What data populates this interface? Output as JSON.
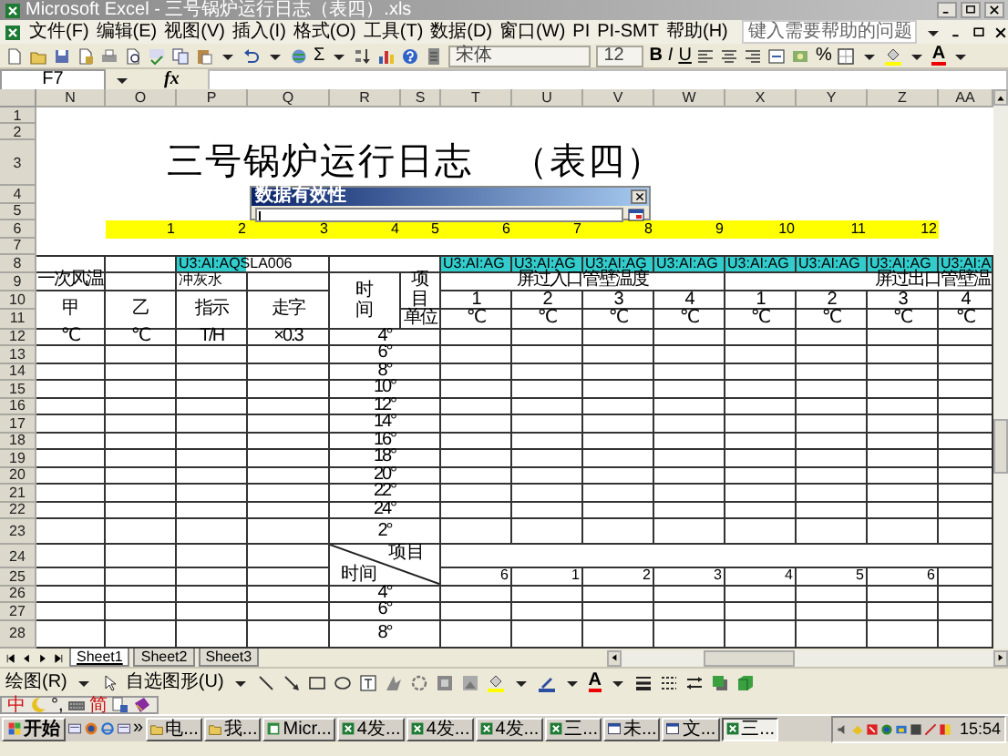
{
  "window": {
    "title": "Microsoft Excel - 三号锅炉运行日志（表四）.xls"
  },
  "menu": [
    "文件(F)",
    "编辑(E)",
    "视图(V)",
    "插入(I)",
    "格式(O)",
    "工具(T)",
    "数据(D)",
    "窗口(W)",
    "PI",
    "PI-SMT",
    "帮助(H)"
  ],
  "help_box": {
    "placeholder": "键入需要帮助的问题"
  },
  "toolbar": {
    "autosum": "Σ",
    "font": "宋体",
    "font_size": "12",
    "bold": "B",
    "italic": "I",
    "underline": "U",
    "percent": "%",
    "font_color": "A"
  },
  "formula_bar": {
    "name_box": "F7",
    "function": "fx"
  },
  "sheet": {
    "columns": [
      "N",
      "O",
      "P",
      "Q",
      "R",
      "S",
      "T",
      "U",
      "V",
      "W",
      "X",
      "Y",
      "Z",
      "AA"
    ],
    "rows": [
      {
        "label": "1"
      },
      {
        "label": "2"
      },
      {
        "label": "3",
        "cells": {
          "P": {
            "kind": "title",
            "text": "三号锅炉运行日志　（表四）"
          }
        }
      },
      {
        "label": "4"
      },
      {
        "label": "5"
      },
      {
        "label": "6",
        "cells": {
          "O": {
            "kind": "number",
            "text": "1",
            "color": "#ffff00"
          },
          "P": {
            "kind": "number",
            "text": "2",
            "color": "#ffff00"
          },
          "Q": {
            "kind": "number",
            "text": "3",
            "color": "#ffff00"
          },
          "R": {
            "kind": "number",
            "text": "4",
            "color": "#ffff00"
          },
          "S": {
            "kind": "number",
            "text": "5",
            "color": "#ffff00"
          },
          "T": {
            "kind": "number",
            "text": "6",
            "color": "#ffff00"
          },
          "U": {
            "kind": "number",
            "text": "7",
            "color": "#ffff00"
          },
          "V": {
            "kind": "number",
            "text": "8",
            "color": "#ffff00"
          },
          "W": {
            "kind": "number",
            "text": "9",
            "color": "#ffff00"
          },
          "X": {
            "kind": "number",
            "text": "10",
            "color": "#ffff00"
          },
          "Y": {
            "kind": "number",
            "text": "11",
            "color": "#ffff00"
          },
          "Z": {
            "kind": "number",
            "text": "12",
            "color": "#ffff00"
          }
        }
      },
      {
        "label": "7"
      },
      {
        "label": "8",
        "cells": {
          "P": {
            "kind": "label",
            "text": "U3:AI:AQSLA006",
            "color": "#33cccc"
          },
          "T": {
            "kind": "label",
            "text": "U3:AI:AG",
            "color": "#33cccc"
          },
          "U": {
            "kind": "label",
            "text": "U3:AI:AG",
            "color": "#33cccc"
          },
          "V": {
            "kind": "label",
            "text": "U3:AI:AG",
            "color": "#33cccc"
          },
          "W": {
            "kind": "label",
            "text": "U3:AI:AG",
            "color": "#33cccc"
          },
          "X": {
            "kind": "label",
            "text": "U3:AI:AG",
            "color": "#33cccc"
          },
          "Y": {
            "kind": "label",
            "text": "U3:AI:AG",
            "color": "#33cccc"
          },
          "Z": {
            "kind": "label",
            "text": "U3:AI:AG",
            "color": "#33cccc"
          },
          "AA": {
            "kind": "label",
            "text": "U3:AI:A",
            "color": "#33cccc"
          }
        }
      },
      {
        "label": "9",
        "cells": {
          "N": {
            "kind": "center",
            "text": "一次风温"
          },
          "P": {
            "kind": "label",
            "text": "冲灰水"
          },
          "R": {
            "kind": "vertical",
            "text": "时间"
          },
          "S": {
            "kind": "vertical",
            "text": "项目"
          },
          "T": {
            "kind": "center",
            "text": "屏过入口管壁温度"
          },
          "X": {
            "kind": "right",
            "text": "屏过出口管壁温"
          }
        }
      },
      {
        "label": "10",
        "cells": {
          "N": {
            "kind": "center",
            "text": "甲"
          },
          "O": {
            "kind": "center",
            "text": "乙"
          },
          "P": {
            "kind": "center",
            "text": "指示"
          },
          "Q": {
            "kind": "center",
            "text": "走字"
          },
          "T": {
            "kind": "center",
            "text": "1"
          },
          "U": {
            "kind": "center",
            "text": "2"
          },
          "V": {
            "kind": "center",
            "text": "3"
          },
          "W": {
            "kind": "center",
            "text": "4"
          },
          "X": {
            "kind": "center",
            "text": "1"
          },
          "Y": {
            "kind": "center",
            "text": "2"
          },
          "Z": {
            "kind": "center",
            "text": "3"
          },
          "AA": {
            "kind": "center",
            "text": "4"
          }
        }
      },
      {
        "label": "11",
        "cells": {
          "S": {
            "kind": "center",
            "text": "单位"
          },
          "T": {
            "kind": "center",
            "text": "℃"
          },
          "U": {
            "kind": "center",
            "text": "℃"
          },
          "V": {
            "kind": "center",
            "text": "℃"
          },
          "W": {
            "kind": "center",
            "text": "℃"
          },
          "X": {
            "kind": "center",
            "text": "℃"
          },
          "Y": {
            "kind": "center",
            "text": "℃"
          },
          "Z": {
            "kind": "center",
            "text": "℃"
          },
          "AA": {
            "kind": "center",
            "text": "℃"
          }
        }
      },
      {
        "label": "12",
        "cells": {
          "N": {
            "kind": "center",
            "text": "℃"
          },
          "O": {
            "kind": "center",
            "text": "℃"
          },
          "P": {
            "kind": "center",
            "text": "T/H"
          },
          "Q": {
            "kind": "center",
            "text": "×0.3"
          },
          "R": {
            "kind": "center",
            "text": "4°"
          }
        }
      },
      {
        "label": "13",
        "cells": {
          "R": {
            "kind": "center",
            "text": "6°"
          }
        }
      },
      {
        "label": "14",
        "cells": {
          "R": {
            "kind": "center",
            "text": "8°"
          }
        }
      },
      {
        "label": "15",
        "cells": {
          "R": {
            "kind": "center",
            "text": "10°"
          }
        }
      },
      {
        "label": "16",
        "cells": {
          "R": {
            "kind": "center",
            "text": "12°"
          }
        }
      },
      {
        "label": "17",
        "cells": {
          "R": {
            "kind": "center",
            "text": "14°"
          }
        }
      },
      {
        "label": "18",
        "cells": {
          "R": {
            "kind": "center",
            "text": "16°"
          }
        }
      },
      {
        "label": "19",
        "cells": {
          "R": {
            "kind": "center",
            "text": "18°"
          }
        }
      },
      {
        "label": "20",
        "cells": {
          "R": {
            "kind": "center",
            "text": "20°"
          }
        }
      },
      {
        "label": "21",
        "cells": {
          "R": {
            "kind": "center",
            "text": "22°"
          }
        }
      },
      {
        "label": "22",
        "cells": {
          "R": {
            "kind": "center",
            "text": "24°"
          }
        }
      },
      {
        "label": "23",
        "cells": {
          "R": {
            "kind": "center",
            "text": "2°"
          }
        }
      },
      {
        "label": "24",
        "cells": {
          "R": {
            "kind": "diagonal",
            "top": "项目",
            "bottom": "时间"
          }
        }
      },
      {
        "label": "25",
        "cells": {
          "T": {
            "kind": "number",
            "text": "6"
          },
          "U": {
            "kind": "number",
            "text": "1"
          },
          "V": {
            "kind": "number",
            "text": "2"
          },
          "W": {
            "kind": "number",
            "text": "3"
          },
          "X": {
            "kind": "number",
            "text": "4"
          },
          "Y": {
            "kind": "number",
            "text": "5"
          },
          "Z": {
            "kind": "number",
            "text": "6"
          }
        }
      },
      {
        "label": "26",
        "cells": {
          "R": {
            "kind": "center",
            "text": "4°"
          }
        }
      },
      {
        "label": "27",
        "cells": {
          "R": {
            "kind": "center",
            "text": "6°"
          }
        }
      },
      {
        "label": "28",
        "cells": {
          "R": {
            "kind": "center",
            "text": "8°"
          }
        }
      }
    ]
  },
  "dialog": {
    "title": "数据有效性"
  },
  "sheet_tabs": [
    {
      "label": "Sheet1",
      "selected": true
    },
    {
      "label": "Sheet2",
      "selected": false
    },
    {
      "label": "Sheet3",
      "selected": false
    }
  ],
  "drawing_toolbar": {
    "draw_menu": "绘图(R)",
    "autoshapes_menu": "自选图形(U)",
    "font_color": "A"
  },
  "ime_bar": {
    "mode": "中",
    "punctuation": "°,",
    "charset": "简"
  },
  "taskbar": {
    "start": "开始",
    "more": "»",
    "buttons": [
      {
        "label": "电...",
        "selected": false
      },
      {
        "label": "我...",
        "selected": false
      },
      {
        "label": "Micr...",
        "selected": false
      },
      {
        "label": "4发...",
        "selected": false
      },
      {
        "label": "4发...",
        "selected": false
      },
      {
        "label": "4发...",
        "selected": false
      },
      {
        "label": "三...",
        "selected": false
      },
      {
        "label": "未...",
        "selected": false
      },
      {
        "label": "文...",
        "selected": false
      },
      {
        "label": "三...",
        "selected": true
      }
    ],
    "clock": "15:54"
  }
}
